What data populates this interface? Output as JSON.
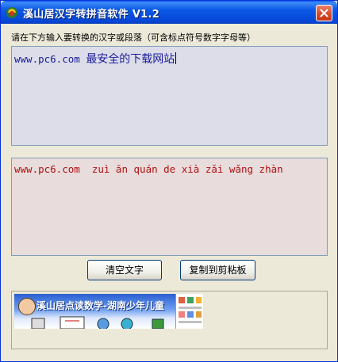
{
  "window": {
    "title": "溪山居汉字转拼音软件  V1.2",
    "close_label": "×"
  },
  "instruction": "请在下方输入要转换的汉字或段落（可含标点符号数字字母等）",
  "input": {
    "latin": "www.pc6.com ",
    "chinese": "最安全的下载网站"
  },
  "output": {
    "value": "www.pc6.com  zuì ān quán de xià zǎi wǎng zhàn"
  },
  "buttons": {
    "clear": "清空文字",
    "copy": "复制到剪粘板"
  },
  "ad": {
    "text": "溪山居点读数学-湖南少年儿童"
  },
  "colors": {
    "titlebar": "#0a58e5",
    "input_bg": "#dcdde8",
    "output_bg": "#e8dcdc",
    "input_text": "#1a1a9e",
    "output_text": "#b01010"
  }
}
